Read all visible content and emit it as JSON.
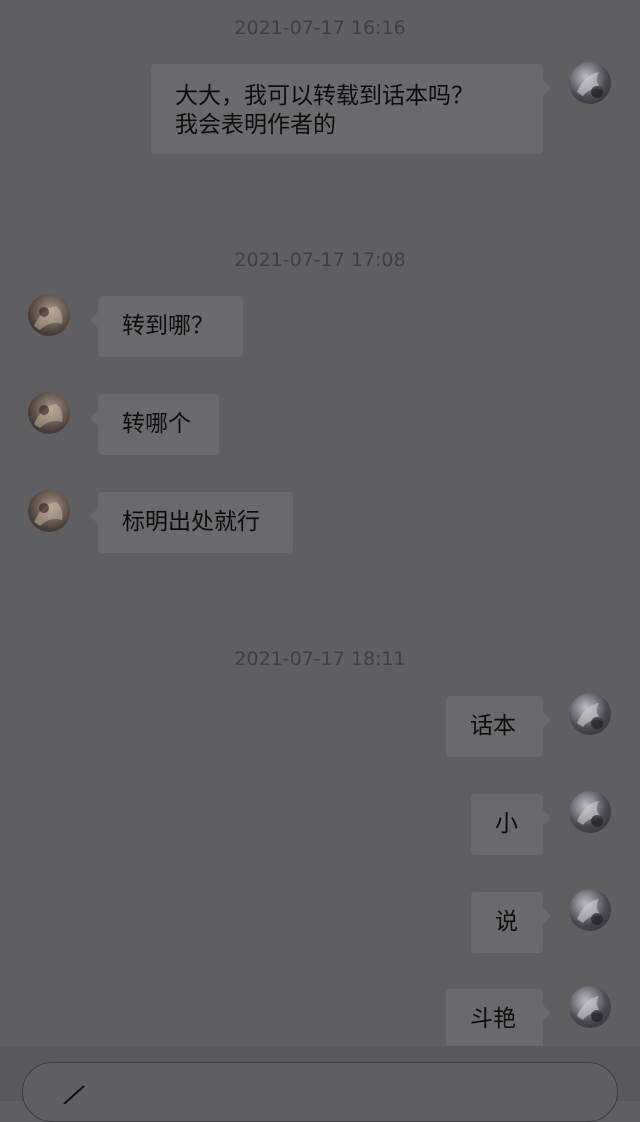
{
  "messages": [
    {
      "type": "timestamp",
      "text": "2021-07-17 16:16"
    },
    {
      "type": "message",
      "sender": "me",
      "lines": [
        "大大，我可以转载到话本吗？",
        "我会表明作者的"
      ]
    },
    {
      "type": "timestamp",
      "text": "2021-07-17 17:08"
    },
    {
      "type": "message",
      "sender": "other",
      "lines": [
        "转到哪？"
      ]
    },
    {
      "type": "message",
      "sender": "other",
      "lines": [
        "转哪个"
      ]
    },
    {
      "type": "message",
      "sender": "other",
      "lines": [
        "标明出处就行"
      ]
    },
    {
      "type": "timestamp",
      "text": "2021-07-17 18:11"
    },
    {
      "type": "message",
      "sender": "me",
      "lines": [
        "话本"
      ]
    },
    {
      "type": "message",
      "sender": "me",
      "lines": [
        "小"
      ]
    },
    {
      "type": "message",
      "sender": "me",
      "lines": [
        "说"
      ]
    },
    {
      "type": "message",
      "sender": "me",
      "lines": [
        "斗艳"
      ]
    }
  ],
  "icons": {
    "input_icon": "pencil-icon"
  },
  "colors": {
    "background": "#5f5f62",
    "bubble": "#6a6a6d",
    "text": "#0d0d0d",
    "timestamp": "#3f3f42"
  }
}
